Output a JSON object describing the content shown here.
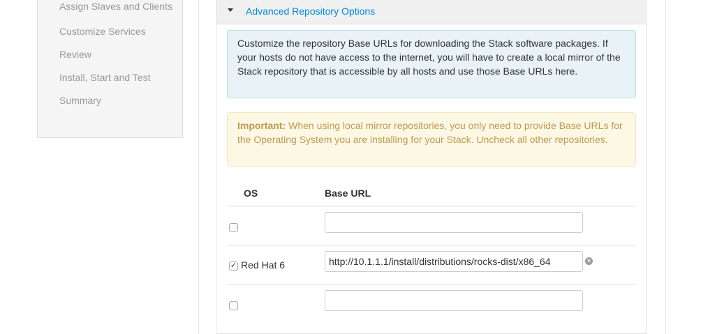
{
  "sidebar": {
    "items": [
      "Assign Slaves and Clients",
      "Customize Services",
      "Review",
      "Install, Start and Test",
      "Summary"
    ]
  },
  "panel": {
    "title": "Advanced Repository Options",
    "info": "Customize the repository Base URLs for downloading the Stack software packages. If your hosts do not have access to the internet, you will have to create a local mirror of the Stack repository that is accessible by all hosts and use those Base URLs here.",
    "warning_label": "Important:",
    "warning": "When using local mirror repositories, you only need to provide Base URLs for the Operating System you are installing for your Stack. Uncheck all other repositories.",
    "table": {
      "headers": [
        "OS",
        "Base URL"
      ],
      "rows": [
        {
          "os": "",
          "checked": false,
          "url": ""
        },
        {
          "os": "Red Hat 6",
          "checked": true,
          "url": "http://10.1.1.1/install/distributions/rocks-dist/x86_64"
        },
        {
          "os": "",
          "checked": false,
          "url": ""
        }
      ]
    }
  }
}
